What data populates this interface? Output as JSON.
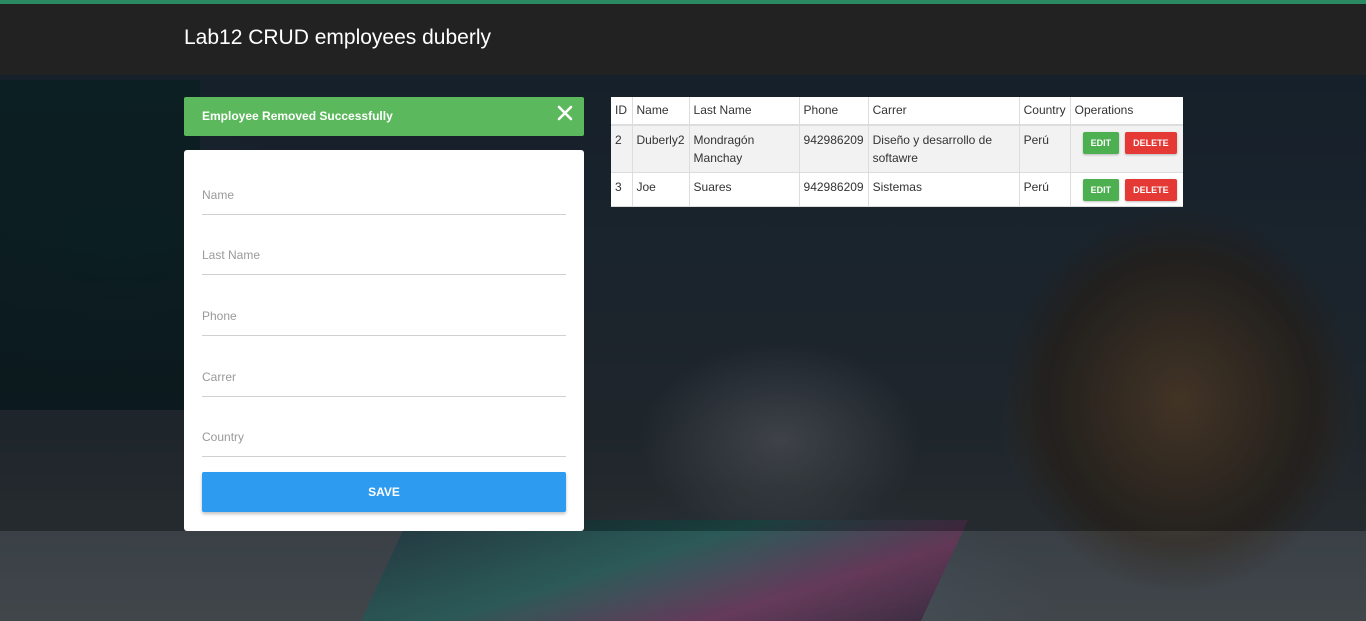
{
  "header": {
    "title": "Lab12 CRUD employees duberly"
  },
  "alert": {
    "message": "Employee Removed Successfully",
    "close_icon": "close-icon",
    "color": "#5cb85c"
  },
  "form": {
    "fields": [
      {
        "placeholder": "Name",
        "value": ""
      },
      {
        "placeholder": "Last Name",
        "value": ""
      },
      {
        "placeholder": "Phone",
        "value": ""
      },
      {
        "placeholder": "Carrer",
        "value": ""
      },
      {
        "placeholder": "Country",
        "value": ""
      }
    ],
    "save_label": "SAVE",
    "save_color": "#2d9bf0"
  },
  "table": {
    "columns": [
      "ID",
      "Name",
      "Last Name",
      "Phone",
      "Carrer",
      "Country",
      "Operations"
    ],
    "rows": [
      {
        "id": "2",
        "name": "Duberly2",
        "last_name": "Mondragón Manchay",
        "phone": "942986209",
        "carrer": "Diseño y desarrollo de softawre",
        "country": "Perú",
        "edit": "EDIT",
        "delete": "DELETE"
      },
      {
        "id": "3",
        "name": "Joe",
        "last_name": "Suares",
        "phone": "942986209",
        "carrer": "Sistemas",
        "country": "Perú",
        "edit": "EDIT",
        "delete": "DELETE"
      }
    ]
  },
  "colors": {
    "edit": "#4caf50",
    "delete": "#e53935",
    "header_bg": "#222222",
    "accent_line": "#2b8a62"
  }
}
